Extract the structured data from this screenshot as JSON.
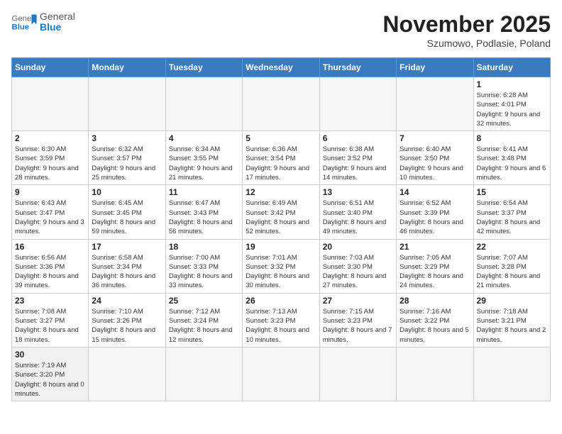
{
  "header": {
    "logo_general": "General",
    "logo_blue": "Blue",
    "month_title": "November 2025",
    "subtitle": "Szumowo, Podlasie, Poland"
  },
  "weekdays": [
    "Sunday",
    "Monday",
    "Tuesday",
    "Wednesday",
    "Thursday",
    "Friday",
    "Saturday"
  ],
  "weeks": [
    [
      {
        "day": "",
        "info": ""
      },
      {
        "day": "",
        "info": ""
      },
      {
        "day": "",
        "info": ""
      },
      {
        "day": "",
        "info": ""
      },
      {
        "day": "",
        "info": ""
      },
      {
        "day": "",
        "info": ""
      },
      {
        "day": "1",
        "info": "Sunrise: 6:28 AM\nSunset: 4:01 PM\nDaylight: 9 hours and 32 minutes."
      }
    ],
    [
      {
        "day": "2",
        "info": "Sunrise: 6:30 AM\nSunset: 3:59 PM\nDaylight: 9 hours and 28 minutes."
      },
      {
        "day": "3",
        "info": "Sunrise: 6:32 AM\nSunset: 3:57 PM\nDaylight: 9 hours and 25 minutes."
      },
      {
        "day": "4",
        "info": "Sunrise: 6:34 AM\nSunset: 3:55 PM\nDaylight: 9 hours and 21 minutes."
      },
      {
        "day": "5",
        "info": "Sunrise: 6:36 AM\nSunset: 3:54 PM\nDaylight: 9 hours and 17 minutes."
      },
      {
        "day": "6",
        "info": "Sunrise: 6:38 AM\nSunset: 3:52 PM\nDaylight: 9 hours and 14 minutes."
      },
      {
        "day": "7",
        "info": "Sunrise: 6:40 AM\nSunset: 3:50 PM\nDaylight: 9 hours and 10 minutes."
      },
      {
        "day": "8",
        "info": "Sunrise: 6:41 AM\nSunset: 3:48 PM\nDaylight: 9 hours and 6 minutes."
      }
    ],
    [
      {
        "day": "9",
        "info": "Sunrise: 6:43 AM\nSunset: 3:47 PM\nDaylight: 9 hours and 3 minutes."
      },
      {
        "day": "10",
        "info": "Sunrise: 6:45 AM\nSunset: 3:45 PM\nDaylight: 8 hours and 59 minutes."
      },
      {
        "day": "11",
        "info": "Sunrise: 6:47 AM\nSunset: 3:43 PM\nDaylight: 8 hours and 56 minutes."
      },
      {
        "day": "12",
        "info": "Sunrise: 6:49 AM\nSunset: 3:42 PM\nDaylight: 8 hours and 52 minutes."
      },
      {
        "day": "13",
        "info": "Sunrise: 6:51 AM\nSunset: 3:40 PM\nDaylight: 8 hours and 49 minutes."
      },
      {
        "day": "14",
        "info": "Sunrise: 6:52 AM\nSunset: 3:39 PM\nDaylight: 8 hours and 46 minutes."
      },
      {
        "day": "15",
        "info": "Sunrise: 6:54 AM\nSunset: 3:37 PM\nDaylight: 8 hours and 42 minutes."
      }
    ],
    [
      {
        "day": "16",
        "info": "Sunrise: 6:56 AM\nSunset: 3:36 PM\nDaylight: 8 hours and 39 minutes."
      },
      {
        "day": "17",
        "info": "Sunrise: 6:58 AM\nSunset: 3:34 PM\nDaylight: 8 hours and 36 minutes."
      },
      {
        "day": "18",
        "info": "Sunrise: 7:00 AM\nSunset: 3:33 PM\nDaylight: 8 hours and 33 minutes."
      },
      {
        "day": "19",
        "info": "Sunrise: 7:01 AM\nSunset: 3:32 PM\nDaylight: 8 hours and 30 minutes."
      },
      {
        "day": "20",
        "info": "Sunrise: 7:03 AM\nSunset: 3:30 PM\nDaylight: 8 hours and 27 minutes."
      },
      {
        "day": "21",
        "info": "Sunrise: 7:05 AM\nSunset: 3:29 PM\nDaylight: 8 hours and 24 minutes."
      },
      {
        "day": "22",
        "info": "Sunrise: 7:07 AM\nSunset: 3:28 PM\nDaylight: 8 hours and 21 minutes."
      }
    ],
    [
      {
        "day": "23",
        "info": "Sunrise: 7:08 AM\nSunset: 3:27 PM\nDaylight: 8 hours and 18 minutes."
      },
      {
        "day": "24",
        "info": "Sunrise: 7:10 AM\nSunset: 3:26 PM\nDaylight: 8 hours and 15 minutes."
      },
      {
        "day": "25",
        "info": "Sunrise: 7:12 AM\nSunset: 3:24 PM\nDaylight: 8 hours and 12 minutes."
      },
      {
        "day": "26",
        "info": "Sunrise: 7:13 AM\nSunset: 3:23 PM\nDaylight: 8 hours and 10 minutes."
      },
      {
        "day": "27",
        "info": "Sunrise: 7:15 AM\nSunset: 3:23 PM\nDaylight: 8 hours and 7 minutes."
      },
      {
        "day": "28",
        "info": "Sunrise: 7:16 AM\nSunset: 3:22 PM\nDaylight: 8 hours and 5 minutes."
      },
      {
        "day": "29",
        "info": "Sunrise: 7:18 AM\nSunset: 3:21 PM\nDaylight: 8 hours and 2 minutes."
      }
    ],
    [
      {
        "day": "30",
        "info": "Sunrise: 7:19 AM\nSunset: 3:20 PM\nDaylight: 8 hours and 0 minutes."
      },
      {
        "day": "",
        "info": ""
      },
      {
        "day": "",
        "info": ""
      },
      {
        "day": "",
        "info": ""
      },
      {
        "day": "",
        "info": ""
      },
      {
        "day": "",
        "info": ""
      },
      {
        "day": "",
        "info": ""
      }
    ]
  ]
}
